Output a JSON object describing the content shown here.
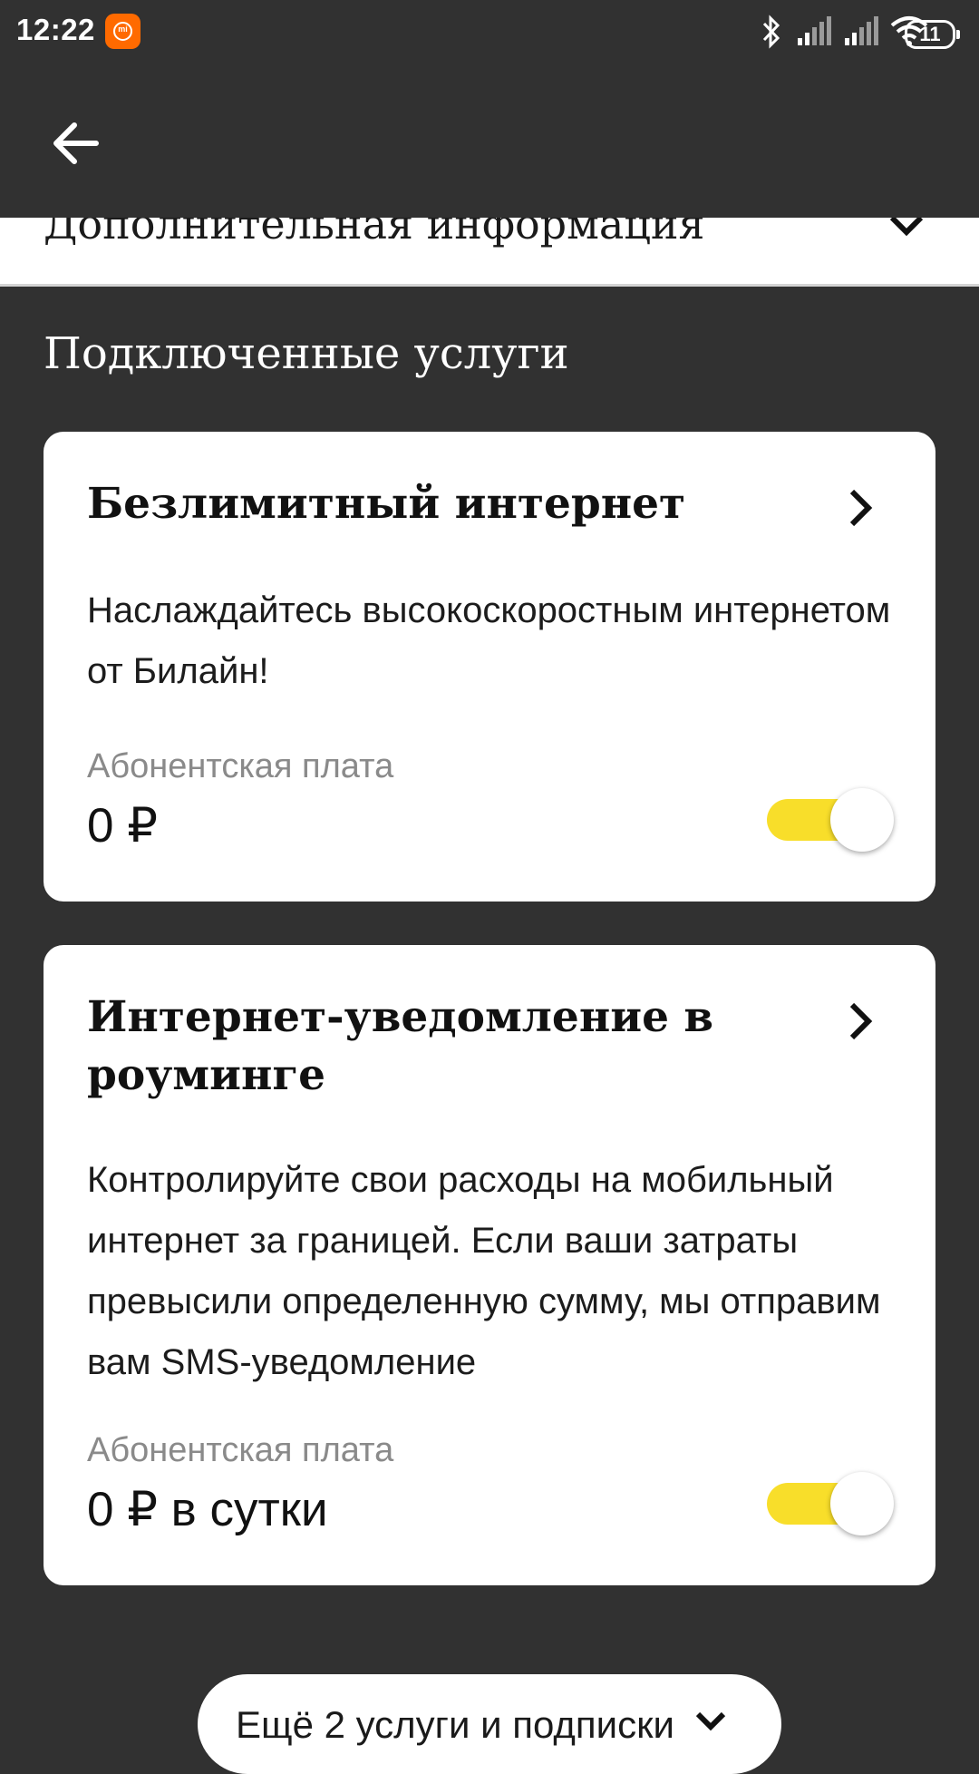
{
  "status_bar": {
    "time": "12:22",
    "battery": "11",
    "icons": [
      "mi-notification-icon",
      "bluetooth-icon",
      "signal-icon",
      "signal-icon",
      "wifi-icon",
      "battery-icon"
    ]
  },
  "toolbar": {
    "back_icon": "arrow-left-icon"
  },
  "info_section": {
    "title": "Дополнительная информация",
    "icon": "chevron-down-icon"
  },
  "services": {
    "title": "Подключенные услуги",
    "items": [
      {
        "title": "Безлимитный интернет",
        "description": "Наслаждайтесь высокоскоростным интернетом от Билайн!",
        "fee_label": "Абонентская плата",
        "price": "0 ₽",
        "enabled": true
      },
      {
        "title": "Интернет-уведомление в роуминге",
        "description": "Контролируйте свои расходы на мобильный интернет за границей. Если ваши затраты превысили определенную сумму, мы отправим вам SMS-уведомление",
        "fee_label": "Абонентская плата",
        "price": "0 ₽ в сутки",
        "enabled": true
      }
    ],
    "more_button": "Ещё 2 услуги и подписки"
  },
  "colors": {
    "background": "#313131",
    "card": "#ffffff",
    "toggle_on": "#f8de2a"
  }
}
